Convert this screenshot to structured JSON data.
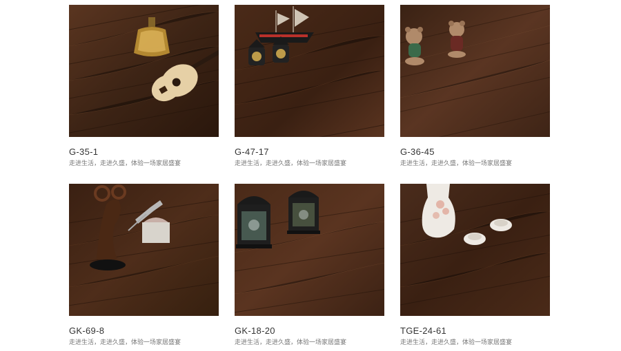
{
  "products": [
    {
      "code": "G-35-1",
      "desc": "走进生活，走进久盛，体验一场家居盛宴",
      "scene": "bottle-and-ukulele-photo"
    },
    {
      "code": "G-47-17",
      "desc": "走进生活，走进久盛，体验一场家居盛宴",
      "scene": "ship-and-lanterns-photo"
    },
    {
      "code": "G-36-45",
      "desc": "走进生活，走进久盛，体验一场家居盛宴",
      "scene": "teddy-bears-photo"
    },
    {
      "code": "GK-69-8",
      "desc": "走进生活，走进久盛，体验一场家居盛宴",
      "scene": "sculpture-and-bird-photo"
    },
    {
      "code": "GK-18-20",
      "desc": "走进生活，走进久盛，体验一场家居盛宴",
      "scene": "moroccan-lanterns-photo"
    },
    {
      "code": "TGE-24-61",
      "desc": "走进生活，走进久盛，体验一场家居盛宴",
      "scene": "vase-and-dishes-photo"
    }
  ],
  "colors": {
    "wood_dark": "#2e1a10",
    "wood_mid": "#4a2c1c",
    "wood_light": "#6a422a",
    "code_text": "#333333",
    "desc_text": "#777777"
  }
}
